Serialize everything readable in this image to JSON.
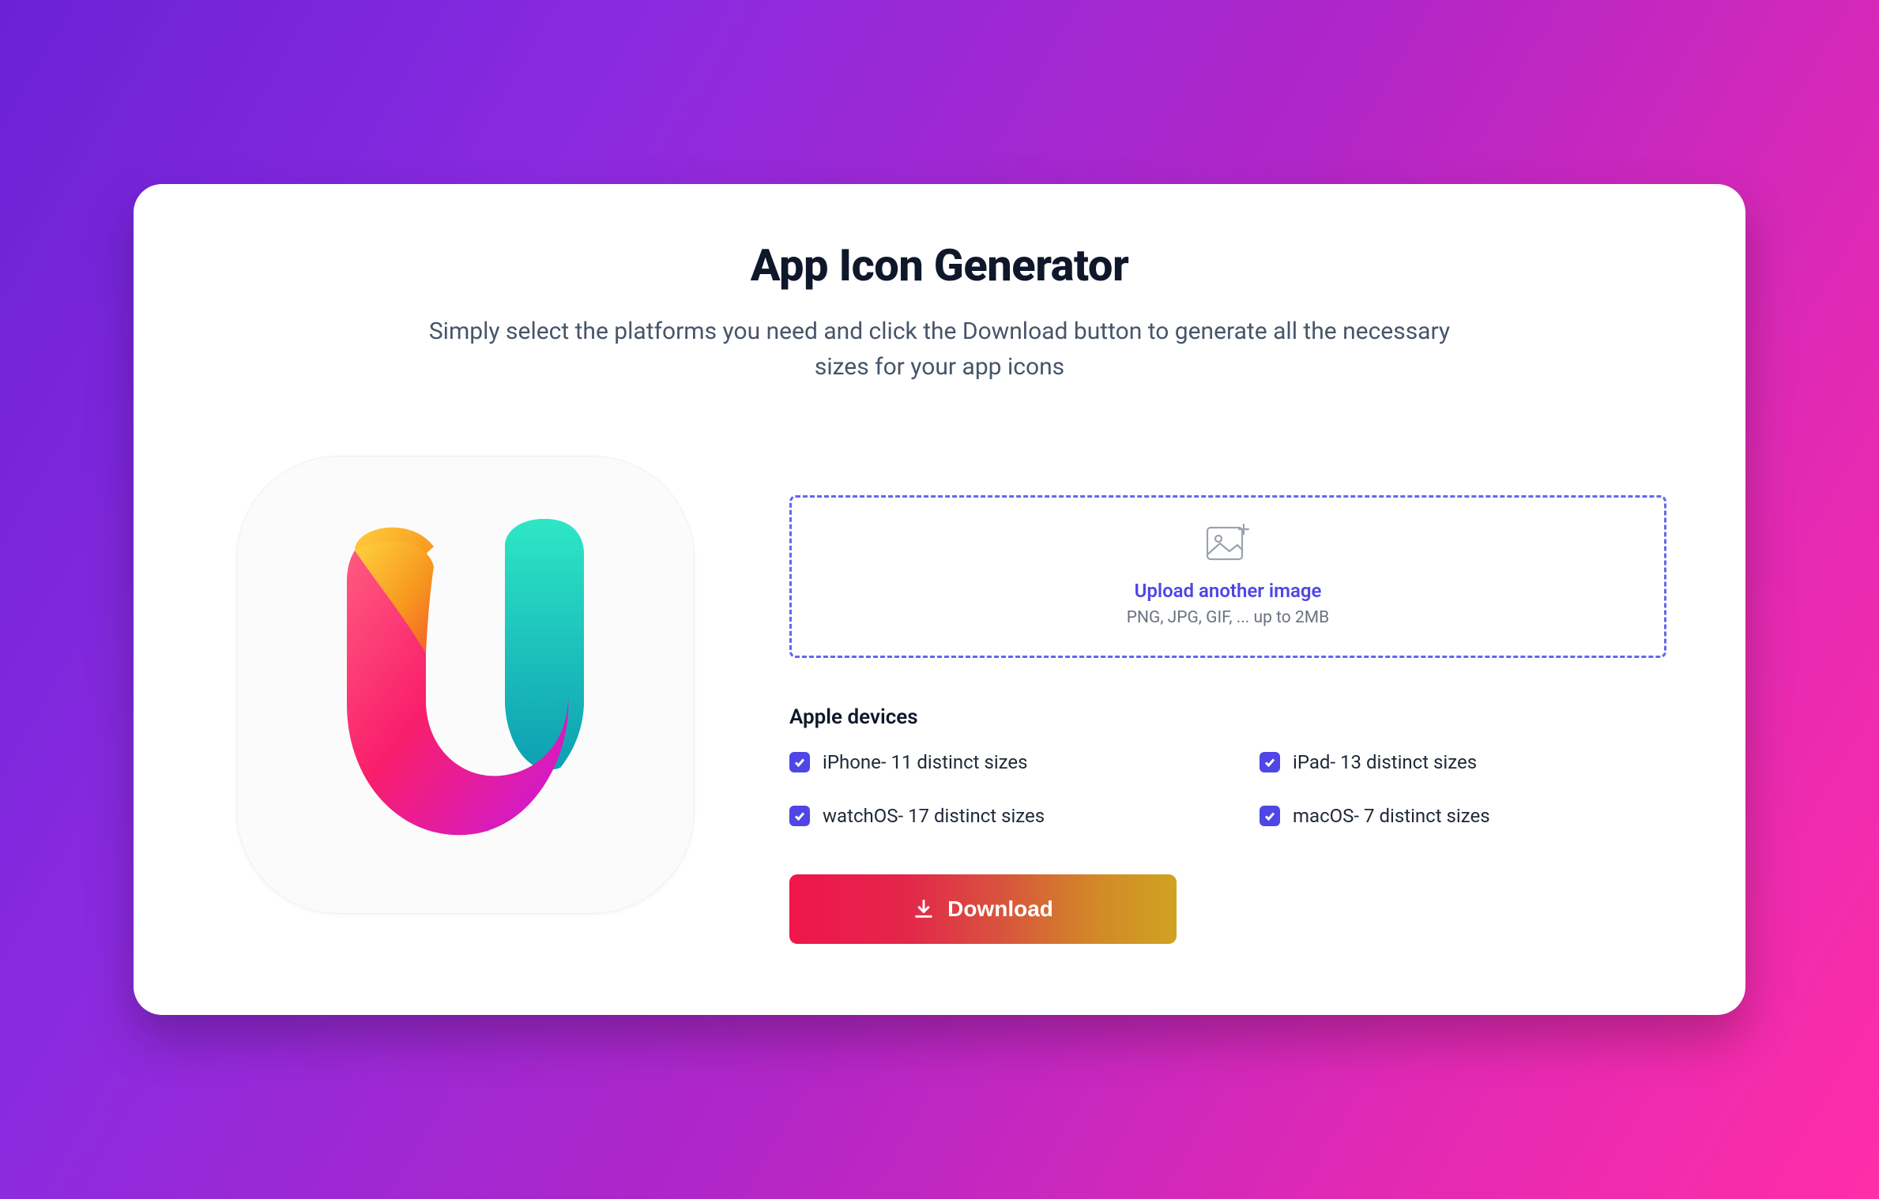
{
  "header": {
    "title": "App Icon Generator",
    "subtitle": "Simply select the platforms you need and click the Download button to generate all the necessary sizes for your app icons"
  },
  "dropzone": {
    "label": "Upload another image",
    "hint": "PNG, JPG, GIF, ... up to 2MB"
  },
  "options_section": {
    "title": "Apple devices"
  },
  "options": [
    {
      "label": "iPhone- 11 distinct sizes",
      "checked": true
    },
    {
      "label": "iPad- 13 distinct sizes",
      "checked": true
    },
    {
      "label": "watchOS- 17 distinct sizes",
      "checked": true
    },
    {
      "label": "macOS- 7 distinct sizes",
      "checked": true
    }
  ],
  "download": {
    "label": "Download"
  },
  "colors": {
    "accent": "#4f46e5",
    "gradient_start": "#f0154c",
    "gradient_end": "#d0a321"
  }
}
